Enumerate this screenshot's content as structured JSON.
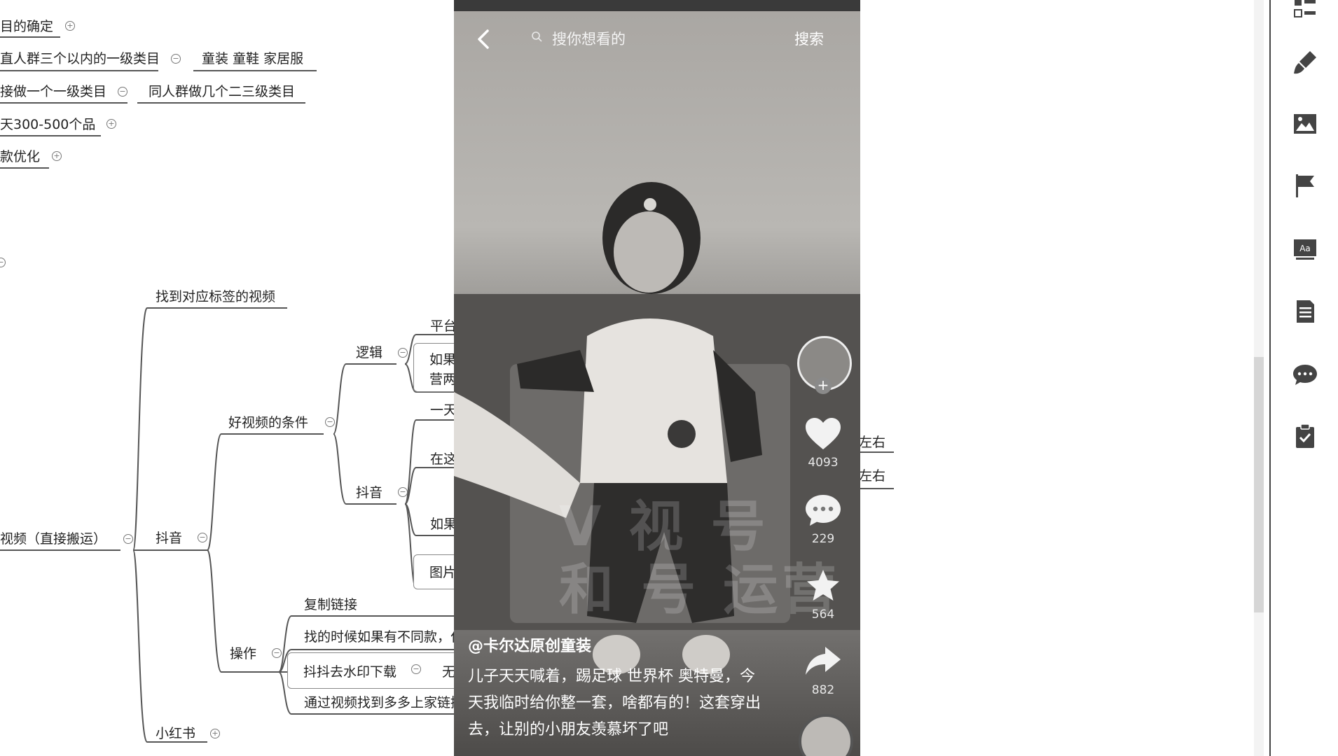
{
  "mindmap": {
    "top_nodes": [
      "目的确定",
      "直人群三个以内的一级类目",
      "童装  童鞋 家居服",
      "接做一个一级类目",
      "同人群做几个二三级类目",
      "天300-500个品",
      "款优化"
    ],
    "branch": {
      "root_label": "视频（直接搬运）",
      "douyin": "抖音",
      "find_tag_video": "找到对应标签的视频",
      "good_video_conditions": "好视频的条件",
      "logic": "逻辑",
      "douyin_sub": "抖音",
      "operation": "操作",
      "xiaohongshu": "小红书",
      "logic_children": [
        "平台",
        "如果",
        "营两"
      ],
      "douyin_children": [
        "一天",
        "在这",
        "如果",
        "图片"
      ],
      "operation_children": [
        "复制链接",
        "找的时候如果有不同款，仁",
        "抖抖去水印下载",
        "无",
        "通过视频找到多多上家链接"
      ],
      "right_fragments": [
        "左右",
        "左右"
      ]
    }
  },
  "video": {
    "search_placeholder": "搜你想看的",
    "search_button": "搜索",
    "watermark_line1": "V  视  号",
    "watermark_line2": "和  号  运营",
    "likes": "4093",
    "comments": "229",
    "favorites": "564",
    "shares": "882",
    "author": "@卡尔达原创童装",
    "caption": "儿子天天喊着，踢足球 世界杯 奥特曼，今天我临时给你整一套，啥都有的！这套穿出去，让别的小朋友羡慕坏了吧"
  },
  "toolbar": {
    "icons": [
      "outline-icon",
      "brush-icon",
      "image-icon",
      "flag-icon",
      "text-style-icon",
      "document-icon",
      "comment-icon",
      "clipboard-check-icon"
    ]
  }
}
